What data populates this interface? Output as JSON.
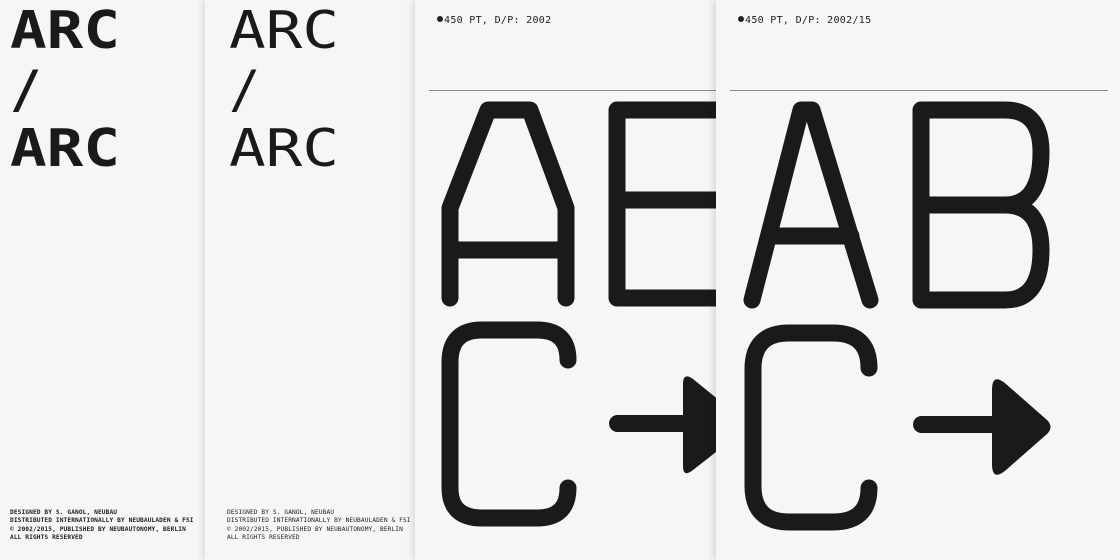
{
  "sheets": [
    {
      "title": [
        "ARC",
        "/",
        "ARC"
      ],
      "credits": [
        "DESIGNED BY S. GANOL, NEUBAU",
        "DISTRIBUTED INTERNATIONALLY BY NEUBAULADEN & FSI",
        "© 2002/2015, PUBLISHED BY NEUBAUTONOMY, BERLIN",
        "ALL RIGHTS RESERVED"
      ]
    },
    {
      "title": [
        "ARC",
        "/",
        "ARC"
      ],
      "credits": [
        "DESIGNED BY S. GANOL, NEUBAU",
        "DISTRIBUTED INTERNATIONALLY BY NEUBAULADEN & FSI",
        "© 2002/2015, PUBLISHED BY NEUBAUTONOMY, BERLIN",
        "ALL RIGHTS RESERVED"
      ]
    },
    {
      "spec": "450 PT, D/P: 2002"
    },
    {
      "spec": "450 PT, D/P: 2002/15"
    }
  ],
  "specimen_glyphs": [
    "A",
    "B",
    "C",
    "right-arrow"
  ],
  "colors": {
    "ink": "#1a1a1a",
    "paper": "#f6f6f6",
    "rule": "#8a8a8a"
  }
}
